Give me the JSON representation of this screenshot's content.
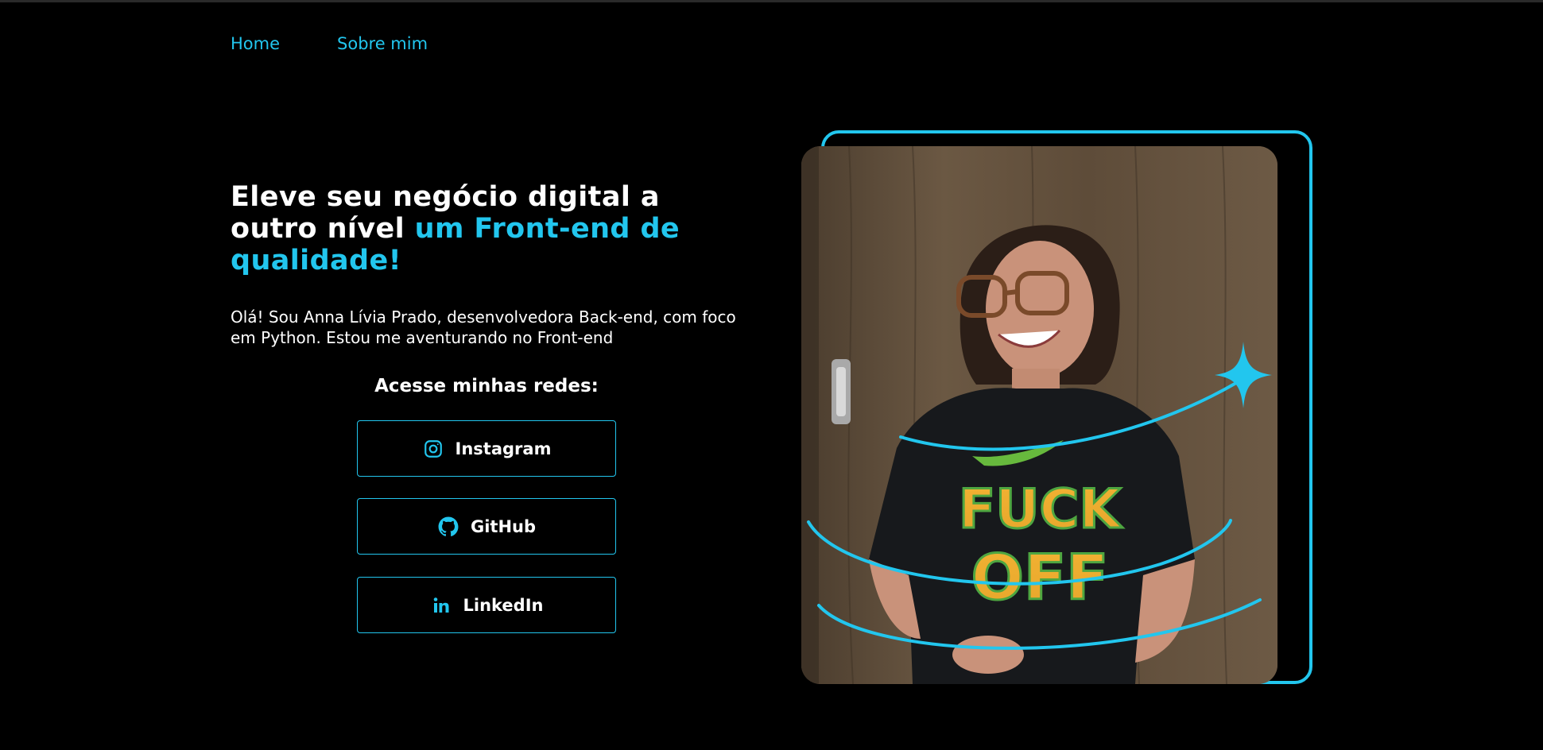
{
  "nav": {
    "home": "Home",
    "about": "Sobre mim"
  },
  "hero": {
    "headline_plain": "Eleve seu negócio digital a outro nível",
    "headline_accent": "um Front-end de qualidade!",
    "intro": "Olá! Sou Anna Lívia Prado, desenvolvedora Back-end, com foco em Python. Estou me aventurando no Front-end"
  },
  "social": {
    "title": "Acesse minhas redes:",
    "buttons": [
      {
        "label": "Instagram",
        "icon": "instagram-icon"
      },
      {
        "label": "GitHub",
        "icon": "github-icon"
      },
      {
        "label": "LinkedIn",
        "icon": "linkedin-icon"
      }
    ]
  },
  "photo": {
    "shirt_text_top": "FUCK",
    "shirt_text_bottom": "OFF"
  },
  "colors": {
    "accent": "#22c6ee",
    "background": "#000000",
    "text": "#ffffff"
  }
}
